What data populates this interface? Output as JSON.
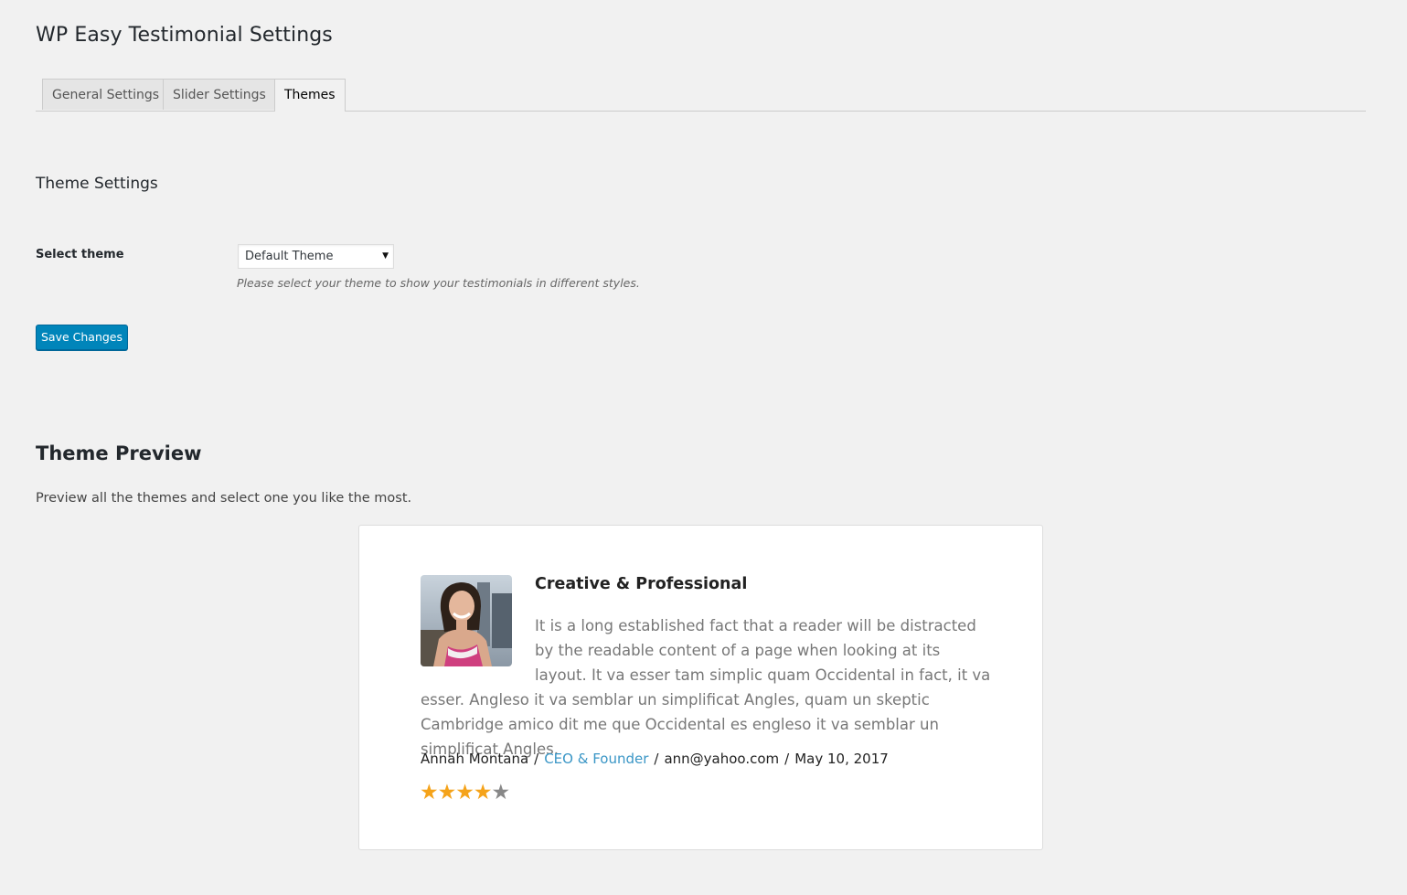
{
  "page": {
    "title": "WP Easy Testimonial Settings"
  },
  "tabs": [
    {
      "label": "General Settings",
      "active": false
    },
    {
      "label": "Slider Settings",
      "active": false
    },
    {
      "label": "Themes",
      "active": true
    }
  ],
  "theme_settings": {
    "heading": "Theme Settings",
    "select_label": "Select theme",
    "select_value": "Default Theme",
    "description": "Please select your theme to show your testimonials in different styles.",
    "save_label": "Save Changes"
  },
  "preview": {
    "heading": "Theme Preview",
    "description": "Preview all the themes and select one you like the most.",
    "testimonial": {
      "title": "Creative & Professional",
      "body": "It is a long established fact that a reader will be distracted by the readable content of a page when looking at its layout. It va esser tam simplic quam Occidental in fact, it va esser. Angleso it va semblar un simplificat Angles, quam un skeptic Cambridge amico dit me que Occidental es engleso it va semblar un simplificat Angles.",
      "name": "Annah Montana",
      "role": "CEO & Founder",
      "email": "ann@yahoo.com",
      "date": "May 10, 2017",
      "separator": "/",
      "rating": 4,
      "rating_max": 5
    }
  },
  "colors": {
    "primary_button": "#0085ba",
    "role_link": "#3a96c6",
    "star_filled": "#f5a31a",
    "star_empty": "#888888"
  }
}
